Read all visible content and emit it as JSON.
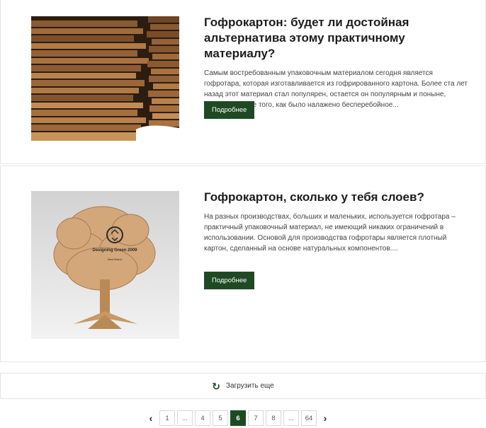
{
  "articles": [
    {
      "title": "Гофрокартон: будет ли достойная альтернатива этому практичному материалу?",
      "excerpt": "Самым востребованным упаковочным материалом сегодня является гофротара, которая изготавливается из гофрированного картона. Более ста лет назад этот материал стал популярен, остается он популярным и поныне, особенно после того, как было налажено бесперебойное...",
      "button": "Подробнее",
      "image_alt": "stacked corrugated cardboard"
    },
    {
      "title": "Гофрокартон, сколько у тебя слоев?",
      "excerpt": "На разных производствах, больших и маленьких, используется гофротара – практичный упаковочный материал, не имеющий никаких ограничений в использовании. Основой для производства гофротары является плотный картон, сделанный на основе натуральных компонентов....",
      "button": "Подробнее",
      "image_text": "Designing Green 2009",
      "image_text_small": "Best Brand"
    }
  ],
  "load_more": {
    "label": "Загрузить еще",
    "icon": "refresh-icon"
  },
  "pagination": {
    "prev": "‹",
    "next": "›",
    "pages": [
      "1",
      "...",
      "4",
      "5",
      "6",
      "7",
      "8",
      "...",
      "64"
    ],
    "active": "6"
  },
  "colors": {
    "accent": "#1e4a23",
    "border": "#e6e6e6"
  }
}
